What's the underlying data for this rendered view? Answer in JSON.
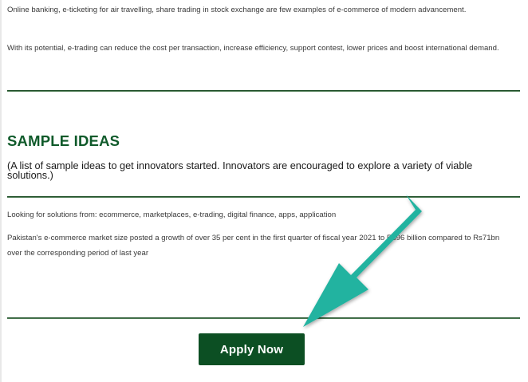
{
  "intro": {
    "paragraph_1": "Online banking, e-ticketing for air travelling, share trading in stock exchange are few examples of e-commerce of modern advancement.",
    "paragraph_2": "With its potential, e-trading can reduce the cost per transaction, increase efficiency, support contest, lower prices and boost international demand."
  },
  "sample_ideas": {
    "title": "SAMPLE IDEAS",
    "subtitle": "(A list of sample ideas to get innovators started. Innovators are encouraged to explore a variety of viable solutions.)",
    "line_1": "Looking for solutions from: ecommerce, marketplaces, e-trading, digital finance, apps, application",
    "line_2": "Pakistan's e-commerce market size posted a growth of over 35 per cent in the first quarter of fiscal year 2021 to Rs96 billion compared to Rs71bn over the corresponding period of last year"
  },
  "actions": {
    "apply_label": "Apply Now"
  },
  "colors": {
    "brand_green": "#0c4f23",
    "heading_green": "#0f5a2a",
    "arrow_teal": "#22b3a0"
  },
  "overlay": {
    "arrow_icon": "arrow-down-left-icon"
  }
}
